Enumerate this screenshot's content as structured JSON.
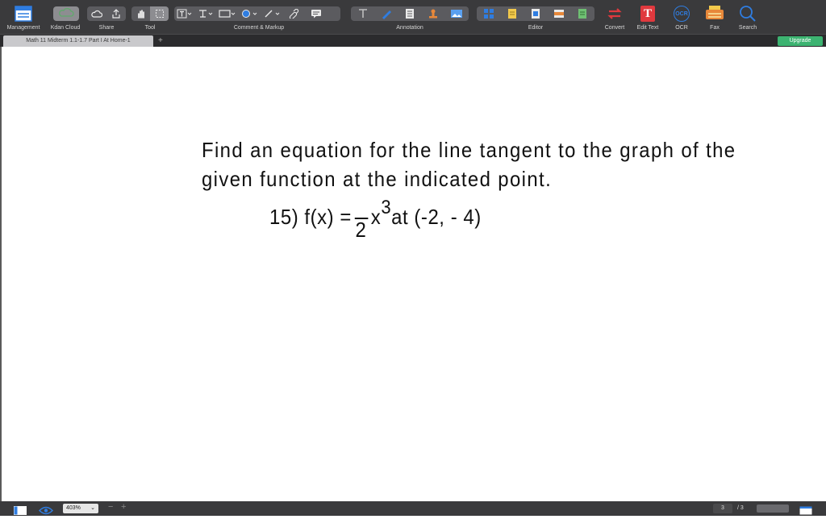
{
  "toolbar": {
    "labels": {
      "management": "Management",
      "kdan_cloud": "Kdan Cloud",
      "share": "Share",
      "tool": "Tool",
      "comment_markup": "Comment & Markup",
      "annotation": "Annotation",
      "editor": "Editor",
      "convert": "Convert",
      "edit_text": "Edit Text",
      "ocr": "OCR",
      "fax": "Fax",
      "search": "Search"
    },
    "ocr_glyph": "OCR",
    "edit_text_glyph": "T",
    "fax_glyph": "FAX"
  },
  "tabs": {
    "active": "Math 11 Midterm 1.1-1.7 Part I At Home-1",
    "add": "+",
    "upgrade": "Upgrade"
  },
  "document": {
    "prompt": "Find an equation for the line tangent to the graph of the given function at the indicated point.",
    "problem": {
      "prefix": "15) f(x) = ",
      "denominator": "2",
      "var": "x",
      "exponent": "3",
      "suffix": "at (-2, - 4)"
    }
  },
  "statusbar": {
    "zoom": "403%",
    "zoom_out": "−",
    "zoom_in": "+",
    "page_current": "3",
    "page_total": "/ 3"
  },
  "colors": {
    "toolbar_bg": "#3a3a3c",
    "upgrade": "#3cb371",
    "accent_blue": "#2f7de1",
    "edit_text_red": "#e0393e"
  }
}
